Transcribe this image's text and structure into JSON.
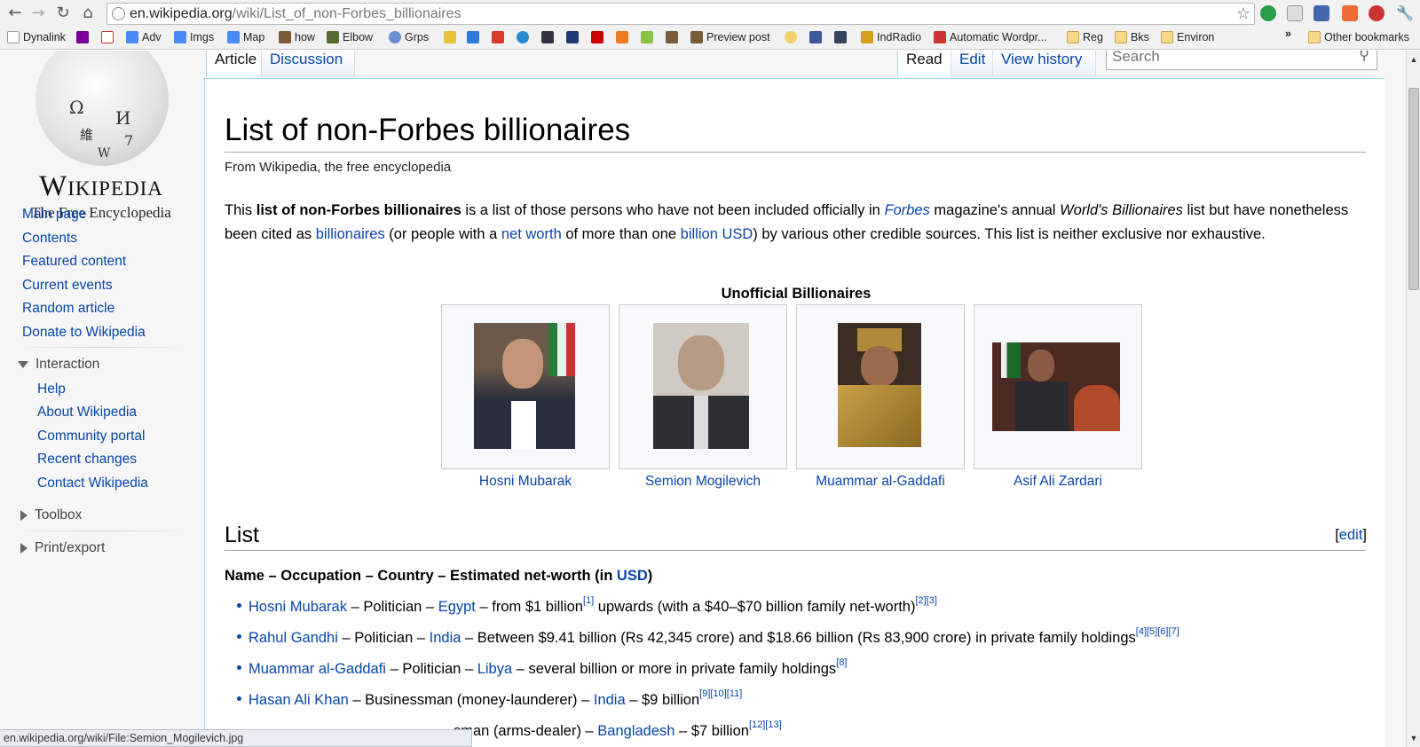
{
  "browser": {
    "url_host": "en.wikipedia.org",
    "url_path": "/wiki/List_of_non-Forbes_billionaires",
    "bookmarks": [
      {
        "label": "Dynalink",
        "icon": "page-icon"
      },
      {
        "label": "",
        "icon": "yahoo-icon"
      },
      {
        "label": "",
        "icon": "gmail-icon"
      },
      {
        "label": "Adv",
        "icon": "google-icon"
      },
      {
        "label": "Imgs",
        "icon": "google-icon"
      },
      {
        "label": "Map",
        "icon": "google-icon"
      },
      {
        "label": "how",
        "icon": "photo-icon"
      },
      {
        "label": "Elbow",
        "icon": "plant-icon"
      },
      {
        "label": "Grps",
        "icon": "groups-icon"
      },
      {
        "label": "Preview post",
        "icon": "photo-icon"
      },
      {
        "label": "IndRadio",
        "icon": "radio-icon"
      },
      {
        "label": "Automatic Wordpr...",
        "icon": "wp-icon"
      },
      {
        "label": "Reg",
        "icon": "folder-icon"
      },
      {
        "label": "Bks",
        "icon": "folder-icon"
      },
      {
        "label": "Environ",
        "icon": "folder-icon"
      },
      {
        "label": "»",
        "icon": ""
      },
      {
        "label": "Other bookmarks",
        "icon": "folder-icon"
      }
    ],
    "status_url": "en.wikipedia.org/wiki/File:Semion_Mogilevich.jpg"
  },
  "logo": {
    "title": "Wikipedia",
    "subtitle": "The Free Encyclopedia"
  },
  "sidebar": {
    "main_links": [
      "Main page",
      "Contents",
      "Featured content",
      "Current events",
      "Random article",
      "Donate to Wikipedia"
    ],
    "interaction": {
      "heading": "Interaction",
      "links": [
        "Help",
        "About Wikipedia",
        "Community portal",
        "Recent changes",
        "Contact Wikipedia"
      ]
    },
    "toolbox": "Toolbox",
    "print_export": "Print/export"
  },
  "tabs": {
    "article": "Article",
    "discussion": "Discussion",
    "read": "Read",
    "edit": "Edit",
    "view_history": "View history",
    "search_placeholder": "Search"
  },
  "article": {
    "title": "List of non-Forbes billionaires",
    "tagline": "From Wikipedia, the free encyclopedia",
    "intro": {
      "p1": "This ",
      "bold": "list of non-Forbes billionaires",
      "p2": " is a list of those persons who have not been included officially in ",
      "forbes": "Forbes",
      "p3": " magazine's annual ",
      "wb": "World's Billionaires",
      "p4": " list but have nonetheless been cited as ",
      "billionaires": "billionaires",
      "p5": " (or people with a ",
      "net_worth": "net worth",
      "p6": " of more than one ",
      "billion_usd": "billion USD",
      "p7": ") by various other credible sources. This list is neither exclusive nor exhaustive."
    },
    "gallery": {
      "title": "Unofficial Billionaires",
      "captions": [
        "Hosni Mubarak",
        "Semion Mogilevich",
        "Muammar al-Gaddafi",
        "Asif Ali Zardari"
      ]
    },
    "list_section": {
      "heading": "List",
      "edit": "edit",
      "header_pre": "Name – Occupation – Country – Estimated net-worth (in ",
      "header_usd": "USD",
      "header_post": ")",
      "items": [
        {
          "name": "Hosni Mubarak",
          "mid1": " – Politician – ",
          "country": "Egypt",
          "rest": " – from $1 billion",
          "ref1": "[1]",
          "rest2": " upwards (with a $40–$70 billion family net-worth)",
          "refs": "[2][3]"
        },
        {
          "name": "Rahul Gandhi",
          "mid1": " – Politician – ",
          "country": "India",
          "rest": " – Between $9.41 billion (Rs 42,345 crore) and $18.66 billion (Rs 83,900 crore) in private family holdings",
          "ref1": "[4][5][6][7]",
          "rest2": "",
          "refs": ""
        },
        {
          "name": "Muammar al-Gaddafi",
          "mid1": " – Politician – ",
          "country": "Libya",
          "rest": " – several billion or more in private family holdings",
          "ref1": "[8]",
          "rest2": "",
          "refs": ""
        },
        {
          "name": "Hasan Ali Khan",
          "mid1": " – Businessman (money-launderer) – ",
          "country": "India",
          "rest": " – $9 billion",
          "ref1": "[9][10][11]",
          "rest2": "",
          "refs": ""
        },
        {
          "name": "",
          "mid1": "sman (arms-dealer) – ",
          "country": "Bangladesh",
          "rest": " – $7 billion",
          "ref1": "[12][13]",
          "rest2": "",
          "refs": ""
        }
      ]
    }
  }
}
